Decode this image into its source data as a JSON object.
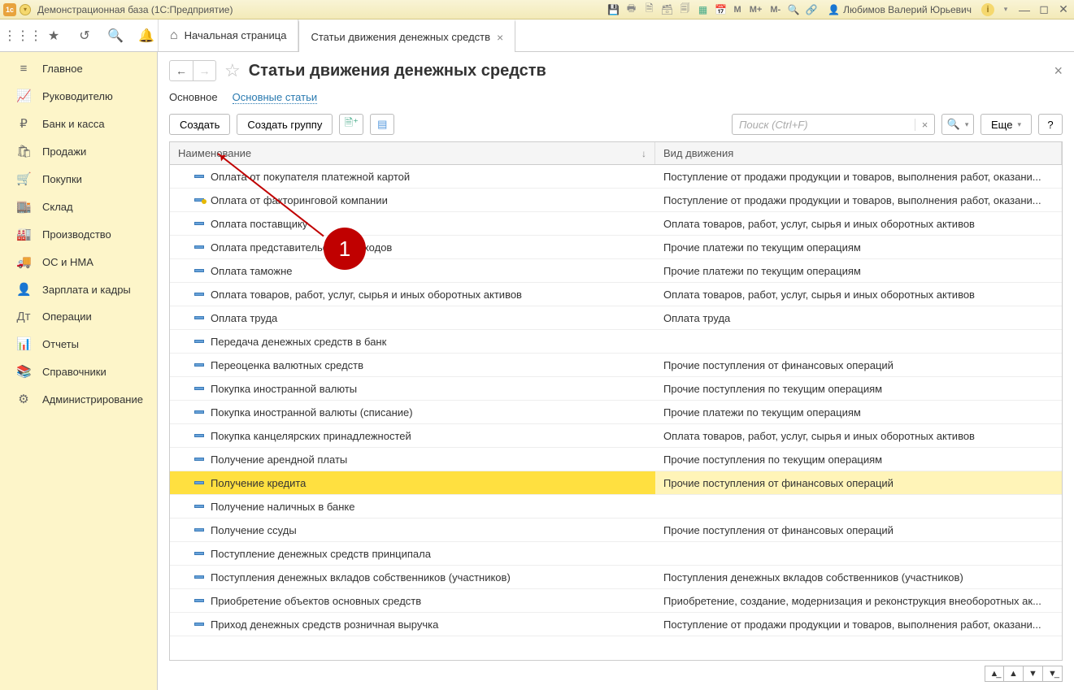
{
  "titlebar": {
    "title": "Демонстрационная база  (1С:Предприятие)",
    "user_name": "Любимов Валерий Юрьевич",
    "m_icons": [
      "M",
      "M+",
      "M-"
    ]
  },
  "tabs": {
    "home": "Начальная страница",
    "active": "Статьи движения денежных средств"
  },
  "sidebar": [
    {
      "icon": "≡",
      "label": "Главное"
    },
    {
      "icon": "📈",
      "label": "Руководителю"
    },
    {
      "icon": "₽",
      "label": "Банк и касса"
    },
    {
      "icon": "🛍",
      "label": "Продажи"
    },
    {
      "icon": "🛒",
      "label": "Покупки"
    },
    {
      "icon": "🏬",
      "label": "Склад"
    },
    {
      "icon": "🏭",
      "label": "Производство"
    },
    {
      "icon": "🚚",
      "label": "ОС и НМА"
    },
    {
      "icon": "👤",
      "label": "Зарплата и кадры"
    },
    {
      "icon": "Дт",
      "label": "Операции"
    },
    {
      "icon": "📊",
      "label": "Отчеты"
    },
    {
      "icon": "📚",
      "label": "Справочники"
    },
    {
      "icon": "⚙",
      "label": "Администрирование"
    }
  ],
  "page": {
    "title": "Статьи движения денежных средств",
    "subtabs": {
      "main": "Основное",
      "link": "Основные статьи"
    }
  },
  "toolbar": {
    "create": "Создать",
    "create_group": "Создать группу",
    "search_placeholder": "Поиск (Ctrl+F)",
    "more": "Еще"
  },
  "table": {
    "col1": "Наименование",
    "col2": "Вид движения",
    "rows": [
      {
        "name": "Оплата от покупателя платежной картой",
        "kind": "Поступление от продажи продукции и товаров, выполнения работ, оказани...",
        "marked": false
      },
      {
        "name": "Оплата от факторинговой компании",
        "kind": "Поступление от продажи продукции и товаров, выполнения работ, оказани...",
        "marked": true
      },
      {
        "name": "Оплата поставщику",
        "kind": "Оплата товаров, работ, услуг, сырья и иных оборотных активов",
        "marked": false
      },
      {
        "name": "Оплата представительских расходов",
        "kind": "Прочие платежи по текущим операциям",
        "marked": false
      },
      {
        "name": "Оплата таможне",
        "kind": "Прочие платежи по текущим операциям",
        "marked": false
      },
      {
        "name": "Оплата товаров, работ, услуг, сырья и иных оборотных активов",
        "kind": "Оплата товаров, работ, услуг, сырья и иных оборотных активов",
        "marked": false
      },
      {
        "name": "Оплата труда",
        "kind": "Оплата труда",
        "marked": false
      },
      {
        "name": "Передача денежных средств в банк",
        "kind": "",
        "marked": false
      },
      {
        "name": "Переоценка валютных средств",
        "kind": "Прочие поступления от финансовых операций",
        "marked": false
      },
      {
        "name": "Покупка иностранной валюты",
        "kind": "Прочие поступления по текущим операциям",
        "marked": false
      },
      {
        "name": "Покупка иностранной валюты (списание)",
        "kind": "Прочие платежи по текущим операциям",
        "marked": false
      },
      {
        "name": "Покупка канцелярских принадлежностей",
        "kind": "Оплата товаров, работ, услуг, сырья и иных оборотных активов",
        "marked": false
      },
      {
        "name": "Получение арендной платы",
        "kind": "Прочие поступления по текущим операциям",
        "marked": false
      },
      {
        "name": "Получение кредита",
        "kind": "Прочие поступления от финансовых операций",
        "marked": false,
        "selected": true
      },
      {
        "name": "Получение наличных в банке",
        "kind": "",
        "marked": false
      },
      {
        "name": "Получение ссуды",
        "kind": "Прочие поступления от финансовых операций",
        "marked": false
      },
      {
        "name": "Поступление денежных средств принципала",
        "kind": "",
        "marked": false
      },
      {
        "name": "Поступления денежных вкладов собственников (участников)",
        "kind": "Поступления денежных вкладов собственников (участников)",
        "marked": false
      },
      {
        "name": "Приобретение объектов основных средств",
        "kind": "Приобретение, создание, модернизация и реконструкция внеоборотных ак...",
        "marked": false
      },
      {
        "name": "Приход денежных средств розничная выручка",
        "kind": "Поступление от продажи продукции и товаров, выполнения работ, оказани...",
        "marked": false
      }
    ]
  },
  "callout": {
    "num": "1"
  }
}
